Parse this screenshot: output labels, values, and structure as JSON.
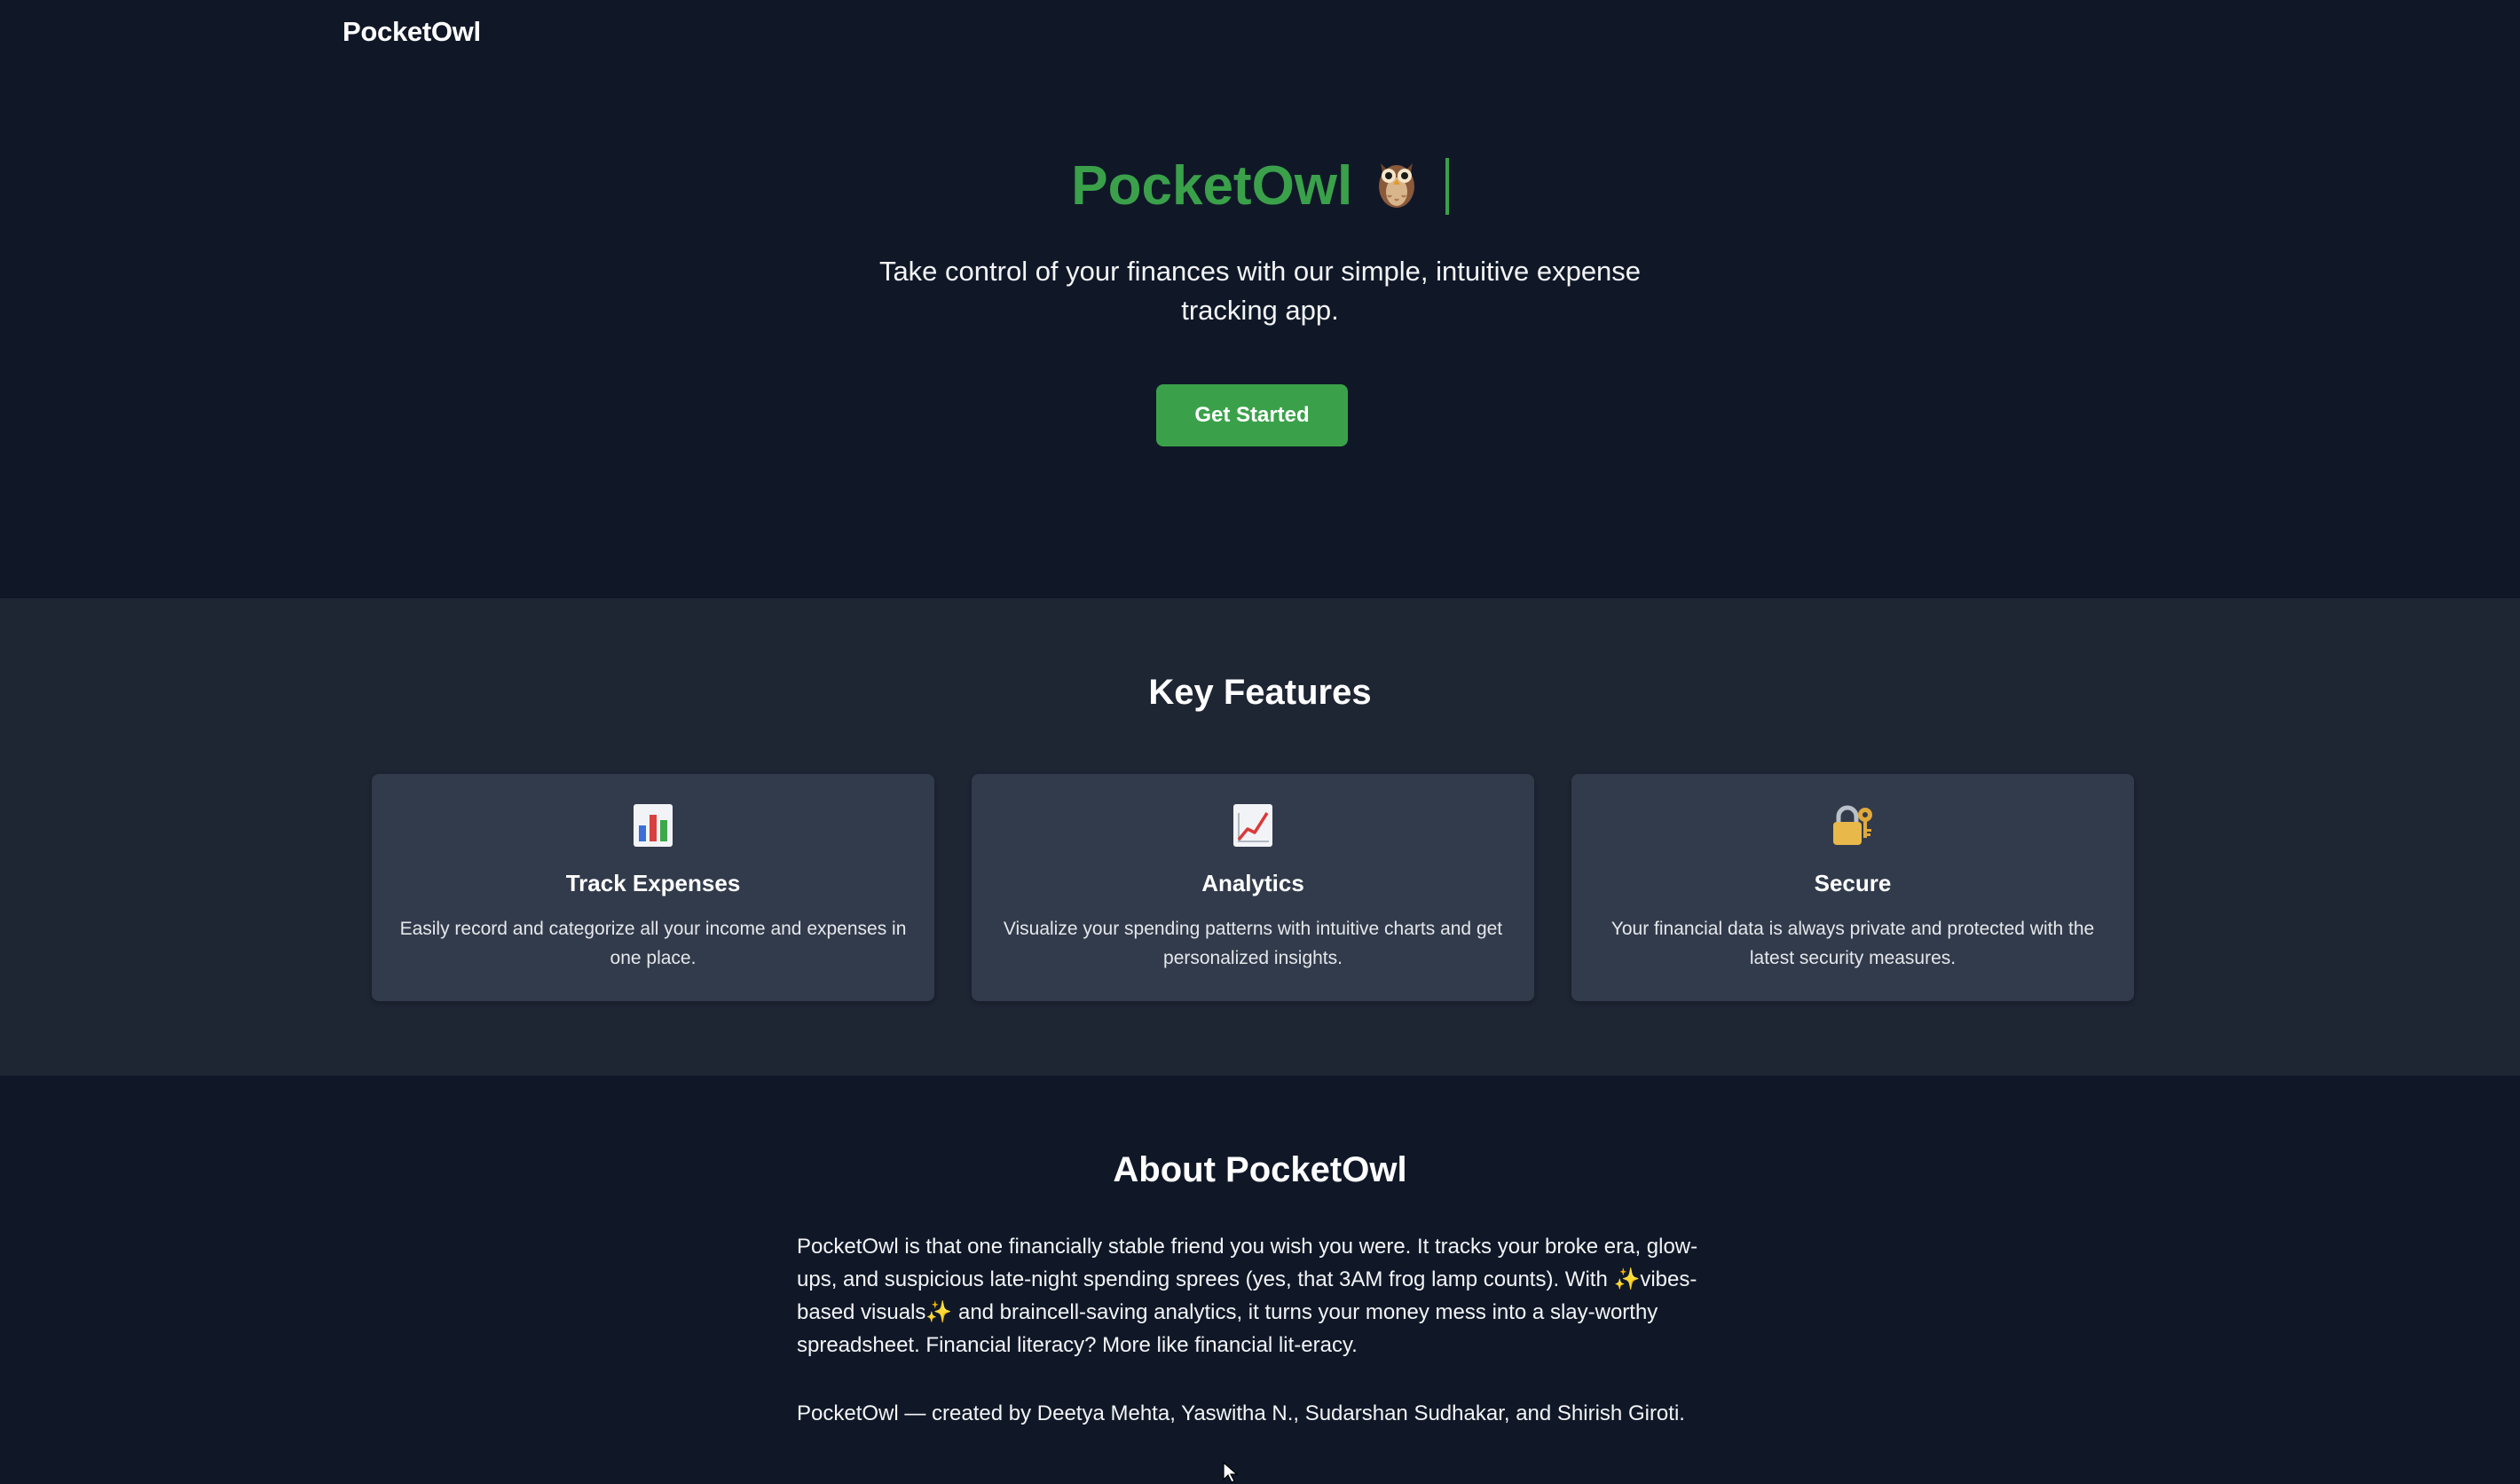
{
  "nav": {
    "brand": "PocketOwl"
  },
  "hero": {
    "title": "PocketOwl",
    "title_icon": "owl-emoji",
    "subtitle": "Take control of your finances with our simple, intuitive expense tracking app.",
    "cta_label": "Get Started",
    "accent_color": "#3aa14a"
  },
  "features": {
    "title": "Key Features",
    "items": [
      {
        "icon": "bar-chart-icon",
        "title": "Track Expenses",
        "description": "Easily record and categorize all your income and expenses in one place."
      },
      {
        "icon": "line-chart-icon",
        "title": "Analytics",
        "description": "Visualize your spending patterns with intuitive charts and get personalized insights."
      },
      {
        "icon": "lock-key-icon",
        "title": "Secure",
        "description": "Your financial data is always private and protected with the latest security measures."
      }
    ]
  },
  "about": {
    "title": "About PocketOwl",
    "body": "PocketOwl is that one financially stable friend you wish you were. It tracks your broke era, glow-ups, and suspicious late-night spending sprees (yes, that 3AM frog lamp counts). With ✨vibes-based visuals✨ and braincell-saving analytics, it turns your money mess into a slay-worthy spreadsheet. Financial literacy? More like financial lit-eracy.",
    "credits": "PocketOwl — created by Deetya Mehta, Yaswitha N., Sudarshan Sudhakar, and Shirish Giroti."
  },
  "colors": {
    "background": "#101828",
    "section_alt": "#1e2533",
    "card": "#323b4b",
    "accent": "#3aa14a"
  }
}
